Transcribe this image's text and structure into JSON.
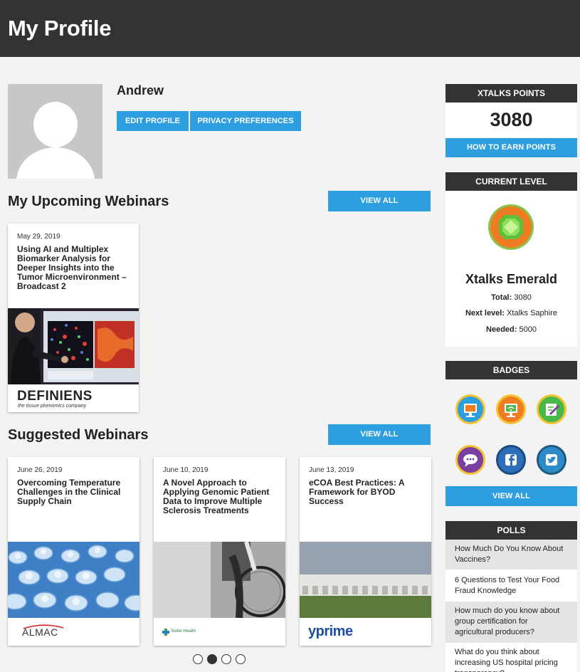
{
  "header": {
    "title": "My Profile"
  },
  "profile": {
    "name": "Andrew",
    "edit_label": "EDIT PROFILE",
    "privacy_label": "PRIVACY PREFERENCES"
  },
  "upcoming": {
    "title": "My Upcoming Webinars",
    "view_all": "VIEW ALL",
    "items": [
      {
        "date": "May 29, 2019",
        "title": "Using AI and Multiplex Biomarker Analysis for Deeper Insights into the Tumor Microenvironment – Broadcast 2",
        "logo": "DEFINIENS",
        "tagline": "the tissue phenomics company"
      }
    ]
  },
  "suggested": {
    "title": "Suggested Webinars",
    "view_all": "VIEW ALL",
    "items": [
      {
        "date": "June 26, 2019",
        "title": "Overcoming Temperature Challenges in the Clinical Supply Chain",
        "logo": "ALMAC"
      },
      {
        "date": "June 10, 2019",
        "title": "A Novel Approach to Applying Genomic Patient Data to Improve Multiple Sclerosis Treatments",
        "logo": "Sutter Health"
      },
      {
        "date": "June 13, 2019",
        "title": "eCOA Best Practices: A Framework for BYOD Success",
        "logo": "yprime"
      }
    ]
  },
  "carousel": {
    "pages": 4,
    "active": 1
  },
  "points": {
    "title": "XTALKS POINTS",
    "value": "3080",
    "earn_label": "HOW TO EARN POINTS"
  },
  "level": {
    "title": "CURRENT LEVEL",
    "name": "Xtalks Emerald",
    "total_label": "Total:",
    "total": "3080",
    "next_label": "Next level:",
    "next": "Xtalks Saphire",
    "needed_label": "Needed:",
    "needed": "5000"
  },
  "badges": {
    "title": "BADGES",
    "view_all": "VIEW ALL",
    "items": [
      {
        "icon": "monitor-icon",
        "color": "#2d9fe0"
      },
      {
        "icon": "wifi-monitor-icon",
        "color": "#ef7b22"
      },
      {
        "icon": "pencil-note-icon",
        "color": "#48b848"
      },
      {
        "icon": "chat-bubble-icon",
        "color": "#7b3fa0"
      },
      {
        "icon": "facebook-icon",
        "color": "#2d6eb8"
      },
      {
        "icon": "twitter-icon",
        "color": "#2d8cc8"
      }
    ]
  },
  "polls": {
    "title": "POLLS",
    "items": [
      "How Much Do You Know About Vaccines?",
      "6 Questions to Test Your Food Fraud Knowledge",
      "How much do you know about group certification for agricultural producers?",
      "What do you think about increasing US hospital pricing transparency?"
    ]
  }
}
